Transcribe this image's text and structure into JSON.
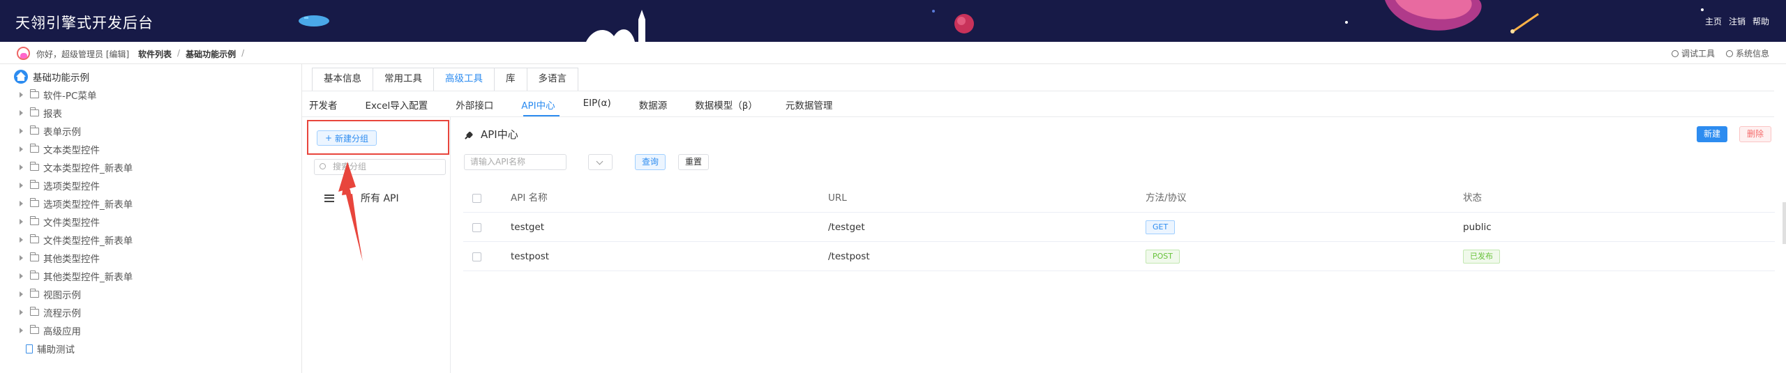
{
  "app": {
    "title": "天翎引擎式开发后台",
    "top_links": [
      "主页",
      "注销",
      "帮助"
    ]
  },
  "breadcrumb_bar": {
    "greeting": "你好，超级管理员 [编辑]",
    "crumbs": [
      "软件列表",
      "/",
      "基础功能示例",
      "/"
    ],
    "right_tools": [
      "调试工具",
      "系统信息"
    ]
  },
  "tree": {
    "root": "基础功能示例",
    "items": [
      {
        "label": "软件-PC菜单",
        "type": "folder"
      },
      {
        "label": "报表",
        "type": "folder"
      },
      {
        "label": "表单示例",
        "type": "folder"
      },
      {
        "label": "文本类型控件",
        "type": "folder"
      },
      {
        "label": "文本类型控件_新表单",
        "type": "folder"
      },
      {
        "label": "选项类型控件",
        "type": "folder"
      },
      {
        "label": "选项类型控件_新表单",
        "type": "folder"
      },
      {
        "label": "文件类型控件",
        "type": "folder"
      },
      {
        "label": "文件类型控件_新表单",
        "type": "folder"
      },
      {
        "label": "其他类型控件",
        "type": "folder"
      },
      {
        "label": "其他类型控件_新表单",
        "type": "folder"
      },
      {
        "label": "视图示例",
        "type": "folder"
      },
      {
        "label": "流程示例",
        "type": "folder"
      },
      {
        "label": "高级应用",
        "type": "folder"
      },
      {
        "label": "辅助测试",
        "type": "doc"
      }
    ]
  },
  "tabs_primary": {
    "items": [
      "基本信息",
      "常用工具",
      "高级工具",
      "库",
      "多语言"
    ],
    "active": "高级工具"
  },
  "tabs_secondary": {
    "items": [
      "开发者",
      "Excel导入配置",
      "外部接口",
      "API中心",
      "EIP(α)",
      "数据源",
      "数据模型（β）",
      "元数据管理"
    ],
    "active": "API中心"
  },
  "group_panel": {
    "new_group_label": "新建分组",
    "search_placeholder": "搜索分组",
    "all_api_label": "所有 API"
  },
  "api_center": {
    "title": "API中心",
    "new_label": "新建",
    "delete_label": "删除",
    "search_placeholder": "请输入API名称",
    "query_label": "查询",
    "reset_label": "重置",
    "columns": [
      "API 名称",
      "URL",
      "方法/协议",
      "状态"
    ],
    "rows": [
      {
        "name": "testget",
        "url": "/testget",
        "method": "GET",
        "status": "public"
      },
      {
        "name": "testpost",
        "url": "/testpost",
        "method": "POST",
        "status": "已发布"
      }
    ]
  },
  "colors": {
    "topbar": "#171a47",
    "accent": "#2d8cf0",
    "highlight_box": "#e8453c",
    "success": "#67c23a"
  }
}
